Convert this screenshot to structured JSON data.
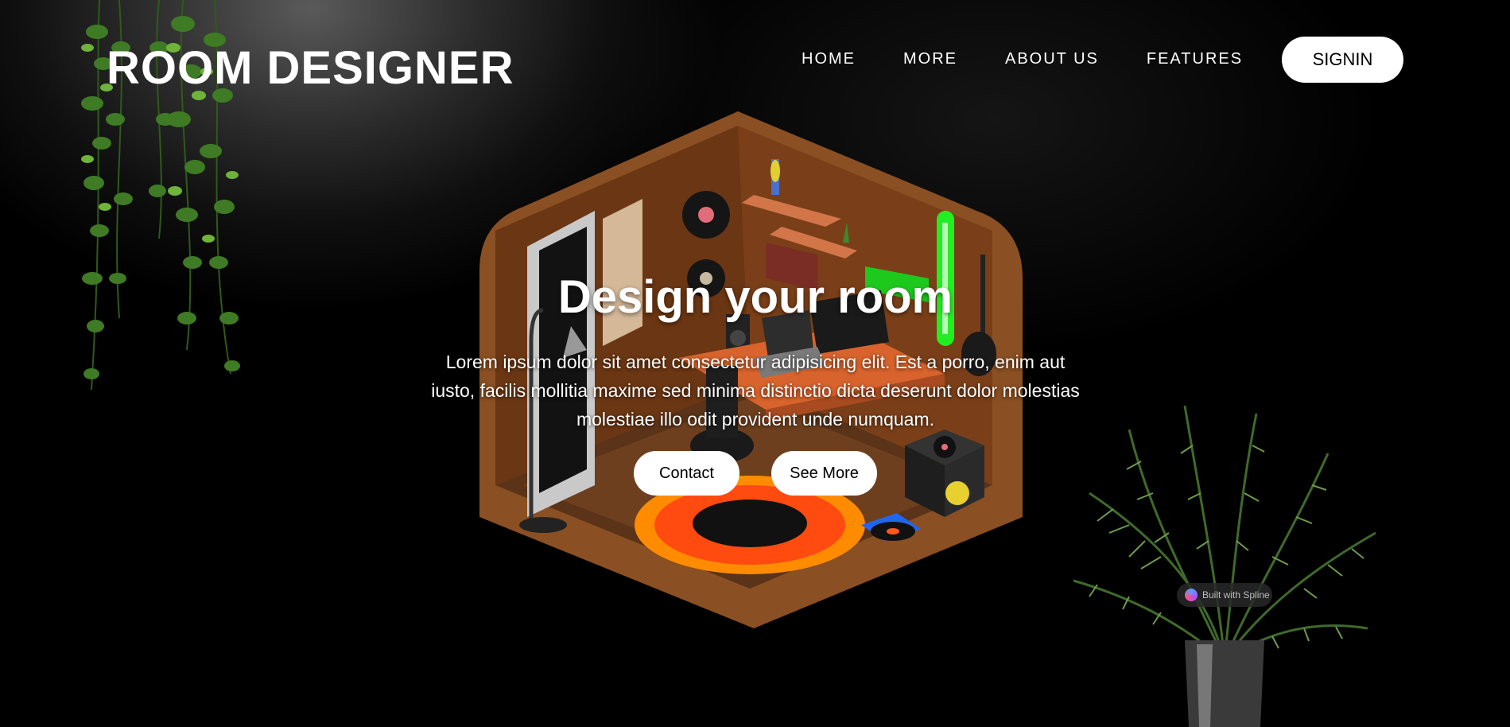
{
  "header": {
    "logo": "ROOM DESIGNER",
    "nav": [
      "HOME",
      "MORE",
      "ABOUT US",
      "FEATURES"
    ],
    "signin_label": "SIGNIN"
  },
  "hero": {
    "title": "Design your room",
    "description": "Lorem ipsum dolor sit amet consectetur adipisicing elit. Est a porro, enim aut iusto, facilis mollitia maxime sed minima distinctio dicta deserunt dolor molestias molestiae illo odit provident unde numquam.",
    "contact_label": "Contact",
    "see_more_label": "See More"
  },
  "badge": {
    "text": "Built with Spline",
    "icon": "spline-logo-icon"
  },
  "colors": {
    "background": "#000000",
    "room_wall": "#8a4f22",
    "rug_outer": "#ff7a00",
    "neon_green": "#22ee22"
  }
}
